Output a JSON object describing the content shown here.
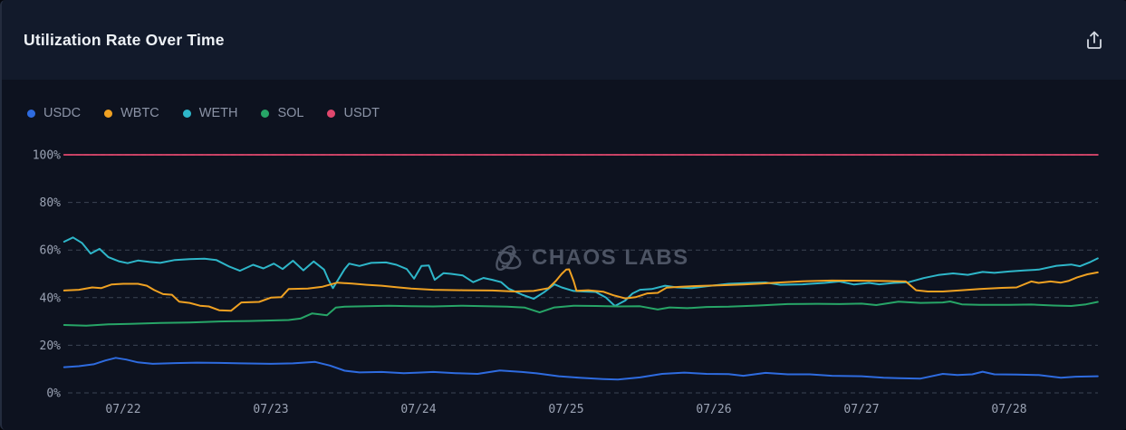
{
  "header": {
    "title": "Utilization Rate Over Time"
  },
  "watermark": {
    "text": "CHAOS LABS"
  },
  "chart_data": {
    "type": "line",
    "title": "Utilization Rate Over Time",
    "unit": "%",
    "grid": "dashed-horizontal",
    "legend_position": "top-left",
    "x_axis": {
      "range_days": [
        21.6,
        28.6
      ],
      "ticks": [
        {
          "day": 22,
          "label": "07/22"
        },
        {
          "day": 23,
          "label": "07/23"
        },
        {
          "day": 24,
          "label": "07/24"
        },
        {
          "day": 25,
          "label": "07/25"
        },
        {
          "day": 26,
          "label": "07/26"
        },
        {
          "day": 27,
          "label": "07/27"
        },
        {
          "day": 28,
          "label": "07/28"
        }
      ]
    },
    "y_axis": {
      "range": [
        0,
        100
      ],
      "ticks": [
        {
          "value": 0,
          "label": "0%"
        },
        {
          "value": 20,
          "label": "20%"
        },
        {
          "value": 40,
          "label": "40%"
        },
        {
          "value": 60,
          "label": "60%"
        },
        {
          "value": 80,
          "label": "80%"
        },
        {
          "value": 100,
          "label": "100%"
        }
      ]
    },
    "series": [
      {
        "name": "USDC",
        "color": "#2e6bdf",
        "points": [
          [
            21.6,
            10.8
          ],
          [
            21.7,
            11.2
          ],
          [
            21.8,
            12.0
          ],
          [
            21.88,
            13.6
          ],
          [
            21.95,
            14.7
          ],
          [
            22.02,
            14.0
          ],
          [
            22.1,
            12.8
          ],
          [
            22.2,
            12.2
          ],
          [
            22.35,
            12.5
          ],
          [
            22.5,
            12.7
          ],
          [
            22.65,
            12.6
          ],
          [
            22.8,
            12.4
          ],
          [
            23.0,
            12.2
          ],
          [
            23.15,
            12.4
          ],
          [
            23.3,
            13.0
          ],
          [
            23.4,
            11.5
          ],
          [
            23.5,
            9.3
          ],
          [
            23.6,
            8.6
          ],
          [
            23.75,
            8.8
          ],
          [
            23.9,
            8.3
          ],
          [
            24.0,
            8.5
          ],
          [
            24.1,
            8.8
          ],
          [
            24.25,
            8.3
          ],
          [
            24.4,
            8.0
          ],
          [
            24.55,
            9.4
          ],
          [
            24.7,
            8.8
          ],
          [
            24.8,
            8.2
          ],
          [
            24.95,
            7.0
          ],
          [
            25.1,
            6.3
          ],
          [
            25.25,
            5.8
          ],
          [
            25.35,
            5.6
          ],
          [
            25.5,
            6.5
          ],
          [
            25.65,
            8.0
          ],
          [
            25.8,
            8.5
          ],
          [
            25.95,
            8.0
          ],
          [
            26.1,
            7.9
          ],
          [
            26.2,
            7.2
          ],
          [
            26.35,
            8.4
          ],
          [
            26.5,
            7.8
          ],
          [
            26.65,
            7.8
          ],
          [
            26.8,
            7.2
          ],
          [
            27.0,
            7.0
          ],
          [
            27.15,
            6.4
          ],
          [
            27.25,
            6.2
          ],
          [
            27.4,
            6.0
          ],
          [
            27.55,
            8.0
          ],
          [
            27.65,
            7.5
          ],
          [
            27.75,
            7.8
          ],
          [
            27.82,
            8.9
          ],
          [
            27.9,
            7.8
          ],
          [
            28.05,
            7.7
          ],
          [
            28.2,
            7.5
          ],
          [
            28.35,
            6.4
          ],
          [
            28.45,
            6.8
          ],
          [
            28.6,
            7.0
          ]
        ]
      },
      {
        "name": "WBTC",
        "color": "#efa122",
        "points": [
          [
            21.6,
            43.0
          ],
          [
            21.7,
            43.3
          ],
          [
            21.79,
            44.3
          ],
          [
            21.85,
            44.0
          ],
          [
            21.92,
            45.5
          ],
          [
            22.0,
            45.8
          ],
          [
            22.1,
            45.8
          ],
          [
            22.16,
            45.0
          ],
          [
            22.21,
            43.2
          ],
          [
            22.27,
            41.5
          ],
          [
            22.33,
            41.2
          ],
          [
            22.38,
            38.3
          ],
          [
            22.45,
            37.8
          ],
          [
            22.52,
            36.6
          ],
          [
            22.58,
            36.3
          ],
          [
            22.65,
            34.7
          ],
          [
            22.73,
            34.5
          ],
          [
            22.8,
            38.0
          ],
          [
            22.92,
            38.2
          ],
          [
            23.0,
            40.0
          ],
          [
            23.07,
            40.2
          ],
          [
            23.12,
            43.6
          ],
          [
            23.25,
            43.8
          ],
          [
            23.35,
            44.6
          ],
          [
            23.45,
            46.3
          ],
          [
            23.55,
            45.9
          ],
          [
            23.65,
            45.4
          ],
          [
            23.75,
            45.0
          ],
          [
            23.85,
            44.4
          ],
          [
            23.95,
            43.8
          ],
          [
            24.1,
            43.3
          ],
          [
            24.3,
            43.1
          ],
          [
            24.5,
            43.0
          ],
          [
            24.65,
            42.6
          ],
          [
            24.78,
            42.8
          ],
          [
            24.88,
            44.0
          ],
          [
            24.93,
            47.0
          ],
          [
            24.97,
            50.0
          ],
          [
            25.0,
            51.8
          ],
          [
            25.02,
            51.9
          ],
          [
            25.05,
            47.0
          ],
          [
            25.07,
            42.9
          ],
          [
            25.15,
            43.1
          ],
          [
            25.25,
            42.5
          ],
          [
            25.32,
            41.0
          ],
          [
            25.4,
            39.7
          ],
          [
            25.47,
            40.2
          ],
          [
            25.55,
            41.8
          ],
          [
            25.62,
            42.0
          ],
          [
            25.68,
            44.2
          ],
          [
            25.78,
            44.6
          ],
          [
            25.9,
            44.9
          ],
          [
            26.05,
            45.2
          ],
          [
            26.2,
            45.5
          ],
          [
            26.32,
            45.9
          ],
          [
            26.45,
            46.4
          ],
          [
            26.6,
            46.9
          ],
          [
            26.8,
            47.2
          ],
          [
            27.0,
            47.1
          ],
          [
            27.15,
            47.0
          ],
          [
            27.3,
            46.8
          ],
          [
            27.37,
            43.1
          ],
          [
            27.45,
            42.6
          ],
          [
            27.55,
            42.6
          ],
          [
            27.68,
            43.1
          ],
          [
            27.8,
            43.6
          ],
          [
            27.95,
            44.1
          ],
          [
            28.05,
            44.3
          ],
          [
            28.15,
            46.8
          ],
          [
            28.2,
            46.2
          ],
          [
            28.28,
            46.8
          ],
          [
            28.35,
            46.3
          ],
          [
            28.4,
            47.0
          ],
          [
            28.46,
            48.5
          ],
          [
            28.53,
            49.8
          ],
          [
            28.6,
            50.6
          ]
        ]
      },
      {
        "name": "WETH",
        "color": "#2eb6c9",
        "points": [
          [
            21.6,
            63.5
          ],
          [
            21.66,
            65.3
          ],
          [
            21.72,
            63.0
          ],
          [
            21.78,
            58.5
          ],
          [
            21.84,
            60.5
          ],
          [
            21.9,
            57.0
          ],
          [
            21.97,
            55.3
          ],
          [
            22.03,
            54.5
          ],
          [
            22.1,
            55.6
          ],
          [
            22.18,
            55.0
          ],
          [
            22.25,
            54.6
          ],
          [
            22.35,
            55.8
          ],
          [
            22.45,
            56.2
          ],
          [
            22.55,
            56.4
          ],
          [
            22.63,
            55.8
          ],
          [
            22.72,
            53.0
          ],
          [
            22.79,
            51.3
          ],
          [
            22.88,
            53.8
          ],
          [
            22.95,
            52.3
          ],
          [
            23.02,
            54.3
          ],
          [
            23.08,
            52.0
          ],
          [
            23.15,
            55.5
          ],
          [
            23.22,
            51.5
          ],
          [
            23.29,
            55.2
          ],
          [
            23.36,
            51.8
          ],
          [
            23.39,
            47.5
          ],
          [
            23.42,
            44.0
          ],
          [
            23.46,
            48.0
          ],
          [
            23.5,
            52.0
          ],
          [
            23.53,
            54.3
          ],
          [
            23.6,
            53.3
          ],
          [
            23.68,
            54.6
          ],
          [
            23.78,
            54.8
          ],
          [
            23.85,
            53.8
          ],
          [
            23.92,
            52.0
          ],
          [
            23.97,
            48.0
          ],
          [
            24.02,
            53.3
          ],
          [
            24.07,
            53.5
          ],
          [
            24.11,
            47.5
          ],
          [
            24.17,
            50.3
          ],
          [
            24.22,
            50.0
          ],
          [
            24.3,
            49.3
          ],
          [
            24.37,
            46.5
          ],
          [
            24.44,
            48.3
          ],
          [
            24.5,
            47.5
          ],
          [
            24.56,
            46.5
          ],
          [
            24.61,
            43.8
          ],
          [
            24.7,
            41.3
          ],
          [
            24.78,
            39.5
          ],
          [
            24.85,
            42.3
          ],
          [
            24.92,
            45.6
          ],
          [
            24.97,
            44.3
          ],
          [
            25.05,
            42.8
          ],
          [
            25.12,
            42.6
          ],
          [
            25.2,
            42.4
          ],
          [
            25.27,
            40.0
          ],
          [
            25.33,
            36.5
          ],
          [
            25.4,
            38.8
          ],
          [
            25.45,
            41.8
          ],
          [
            25.5,
            43.3
          ],
          [
            25.58,
            43.6
          ],
          [
            25.67,
            45.0
          ],
          [
            25.75,
            44.3
          ],
          [
            25.85,
            44.0
          ],
          [
            25.95,
            44.8
          ],
          [
            26.1,
            45.8
          ],
          [
            26.25,
            46.2
          ],
          [
            26.35,
            46.4
          ],
          [
            26.45,
            45.4
          ],
          [
            26.6,
            45.6
          ],
          [
            26.75,
            46.2
          ],
          [
            26.85,
            46.8
          ],
          [
            26.95,
            45.5
          ],
          [
            27.05,
            46.2
          ],
          [
            27.12,
            45.6
          ],
          [
            27.22,
            46.2
          ],
          [
            27.32,
            46.5
          ],
          [
            27.42,
            48.2
          ],
          [
            27.52,
            49.5
          ],
          [
            27.62,
            50.2
          ],
          [
            27.72,
            49.6
          ],
          [
            27.82,
            50.8
          ],
          [
            27.9,
            50.4
          ],
          [
            28.0,
            51.0
          ],
          [
            28.1,
            51.4
          ],
          [
            28.2,
            51.8
          ],
          [
            28.32,
            53.4
          ],
          [
            28.42,
            53.9
          ],
          [
            28.48,
            53.2
          ],
          [
            28.55,
            55.0
          ],
          [
            28.6,
            56.5
          ]
        ]
      },
      {
        "name": "SOL",
        "color": "#27a567",
        "points": [
          [
            21.6,
            28.5
          ],
          [
            21.75,
            28.2
          ],
          [
            21.9,
            28.8
          ],
          [
            22.05,
            29.0
          ],
          [
            22.25,
            29.4
          ],
          [
            22.45,
            29.6
          ],
          [
            22.65,
            30.0
          ],
          [
            22.85,
            30.2
          ],
          [
            23.0,
            30.4
          ],
          [
            23.12,
            30.6
          ],
          [
            23.2,
            31.2
          ],
          [
            23.28,
            33.4
          ],
          [
            23.33,
            33.0
          ],
          [
            23.38,
            32.6
          ],
          [
            23.44,
            35.8
          ],
          [
            23.5,
            36.2
          ],
          [
            23.65,
            36.4
          ],
          [
            23.8,
            36.6
          ],
          [
            23.95,
            36.4
          ],
          [
            24.1,
            36.3
          ],
          [
            24.3,
            36.6
          ],
          [
            24.45,
            36.4
          ],
          [
            24.6,
            36.2
          ],
          [
            24.72,
            35.8
          ],
          [
            24.82,
            33.8
          ],
          [
            24.92,
            35.9
          ],
          [
            25.05,
            36.6
          ],
          [
            25.2,
            36.5
          ],
          [
            25.35,
            36.3
          ],
          [
            25.5,
            36.4
          ],
          [
            25.62,
            35.0
          ],
          [
            25.7,
            35.9
          ],
          [
            25.82,
            35.6
          ],
          [
            25.95,
            36.1
          ],
          [
            26.1,
            36.2
          ],
          [
            26.3,
            36.7
          ],
          [
            26.5,
            37.3
          ],
          [
            26.7,
            37.4
          ],
          [
            26.85,
            37.3
          ],
          [
            27.0,
            37.5
          ],
          [
            27.1,
            36.9
          ],
          [
            27.25,
            38.3
          ],
          [
            27.4,
            37.8
          ],
          [
            27.55,
            38.0
          ],
          [
            27.6,
            38.4
          ],
          [
            27.68,
            37.2
          ],
          [
            27.8,
            37.0
          ],
          [
            28.0,
            37.0
          ],
          [
            28.15,
            37.1
          ],
          [
            28.3,
            36.7
          ],
          [
            28.42,
            36.5
          ],
          [
            28.52,
            37.2
          ],
          [
            28.6,
            38.2
          ]
        ]
      },
      {
        "name": "USDT",
        "color": "#e0476d",
        "points": [
          [
            21.6,
            100
          ],
          [
            28.6,
            100
          ]
        ]
      }
    ]
  }
}
